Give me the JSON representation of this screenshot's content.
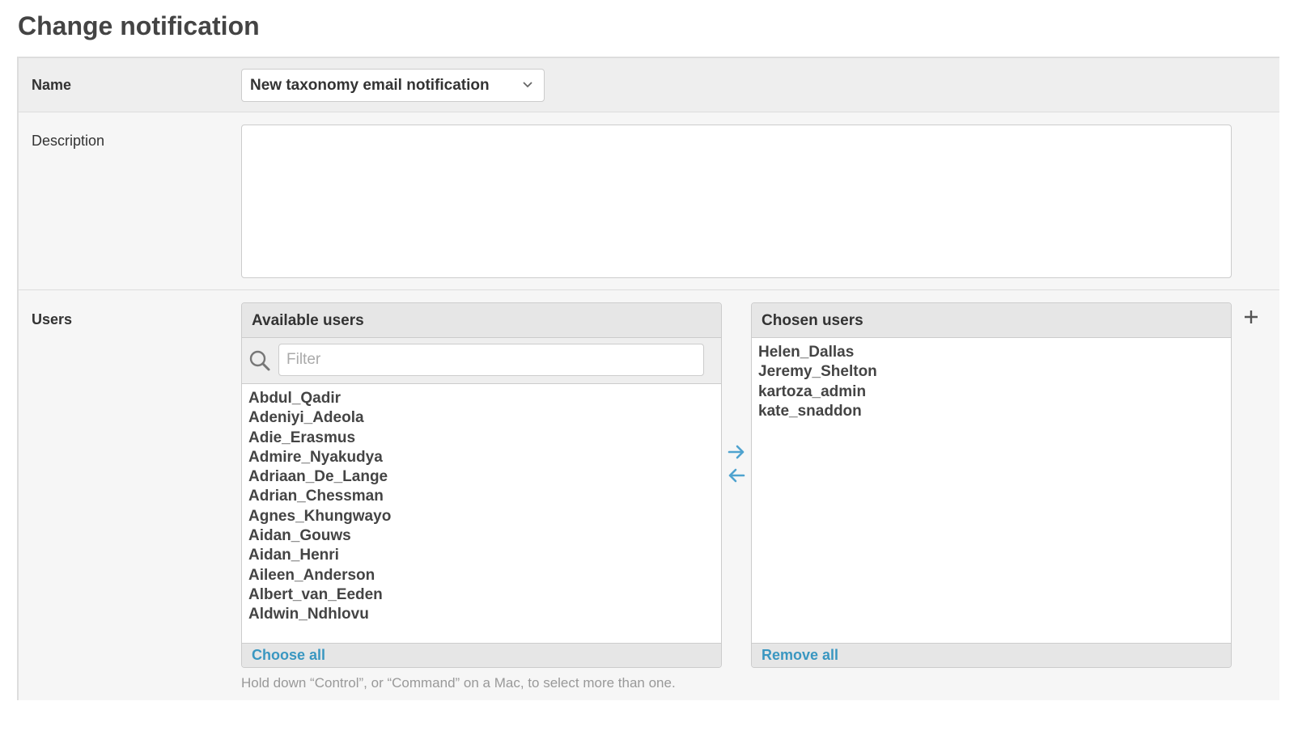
{
  "page": {
    "title": "Change notification"
  },
  "name_field": {
    "label": "Name",
    "value": "New taxonomy email notification"
  },
  "description_field": {
    "label": "Description",
    "value": ""
  },
  "users_field": {
    "label": "Users",
    "available": {
      "title": "Available users",
      "filter_placeholder": "Filter",
      "items": [
        "Abdul_Qadir",
        "Adeniyi_Adeola",
        "Adie_Erasmus",
        "Admire_Nyakudya",
        "Adriaan_De_Lange",
        "Adrian_Chessman",
        "Agnes_Khungwayo",
        "Aidan_Gouws",
        "Aidan_Henri",
        "Aileen_Anderson",
        "Albert_van_Eeden",
        "Aldwin_Ndhlovu"
      ],
      "action_label": "Choose all"
    },
    "chosen": {
      "title": "Chosen users",
      "items": [
        "Helen_Dallas",
        "Jeremy_Shelton",
        "kartoza_admin",
        "kate_snaddon"
      ],
      "action_label": "Remove all"
    },
    "help_text": "Hold down “Control”, or “Command” on a Mac, to select more than one."
  },
  "icons": {
    "select_chevron": "chevron-down-icon",
    "filter": "search-icon",
    "add": "arrow-right-icon",
    "remove": "arrow-left-icon",
    "add_related": "plus-icon"
  },
  "colors": {
    "link": "#3a97c1",
    "header_bg": "#e6e6e6",
    "row_bg": "#f6f6f6"
  }
}
